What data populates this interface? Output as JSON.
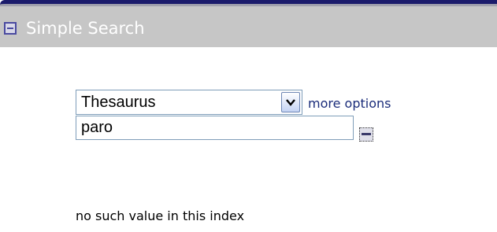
{
  "panel": {
    "title": "Simple Search",
    "toggle_icon": "collapse-icon"
  },
  "search": {
    "index_label": "Thesaurus",
    "more_options_label": "more options",
    "query_value": "paro",
    "lookup_icon": "lookup-icon"
  },
  "status": {
    "message": "no such value in this index"
  },
  "colors": {
    "header_bg": "#c6c6c6",
    "header_border": "#1b1b6b",
    "link": "#1a2c7a"
  }
}
